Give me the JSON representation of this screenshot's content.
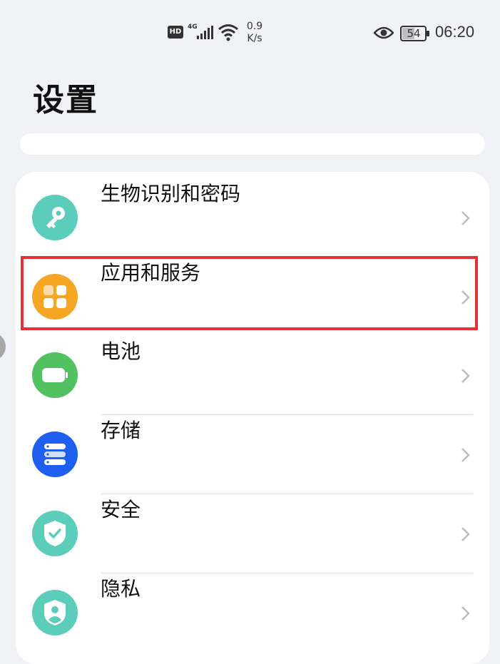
{
  "status_bar": {
    "hd": "HD",
    "network": "4G",
    "speed_value": "0.9",
    "speed_unit": "K/s",
    "battery": "54",
    "time": "06:20"
  },
  "page": {
    "title": "设置"
  },
  "settings": [
    {
      "label": "生物识别和密码",
      "icon": "key-icon",
      "color": "#5ccdbb"
    },
    {
      "label": "应用和服务",
      "icon": "apps-icon",
      "color": "#f5a623"
    },
    {
      "label": "电池",
      "icon": "battery-icon",
      "color": "#52c15f"
    },
    {
      "label": "存储",
      "icon": "storage-icon",
      "color": "#1e5ef0"
    },
    {
      "label": "安全",
      "icon": "shield-check-icon",
      "color": "#5ccdbb"
    },
    {
      "label": "隐私",
      "icon": "privacy-shield-icon",
      "color": "#5ccdbb"
    }
  ],
  "highlight_color": "#ea2f34"
}
